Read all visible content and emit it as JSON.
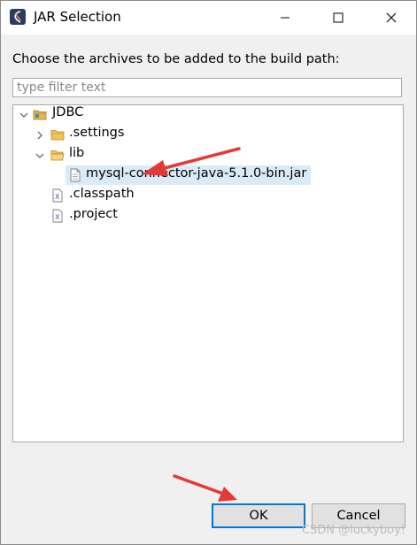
{
  "window": {
    "title": "JAR Selection"
  },
  "prompt": "Choose the archives to be added to the build path:",
  "filter": {
    "placeholder": "type filter text",
    "value": ""
  },
  "tree": {
    "root": "JDBC",
    "items": [
      {
        "label": ".settings",
        "type": "folder",
        "expanded": false
      },
      {
        "label": "lib",
        "type": "folder",
        "expanded": true
      },
      {
        "label": "mysql-connector-java-5.1.0-bin.jar",
        "type": "jar",
        "selected": true
      },
      {
        "label": ".classpath",
        "type": "xml-file"
      },
      {
        "label": ".project",
        "type": "xml-file"
      }
    ]
  },
  "buttons": {
    "ok": "OK",
    "cancel": "Cancel"
  },
  "watermark": "CSDN @luckyboy!",
  "colors": {
    "accent": "#0078d7",
    "selection": "#d9ebf9",
    "annotation_arrow": "#e53935"
  }
}
